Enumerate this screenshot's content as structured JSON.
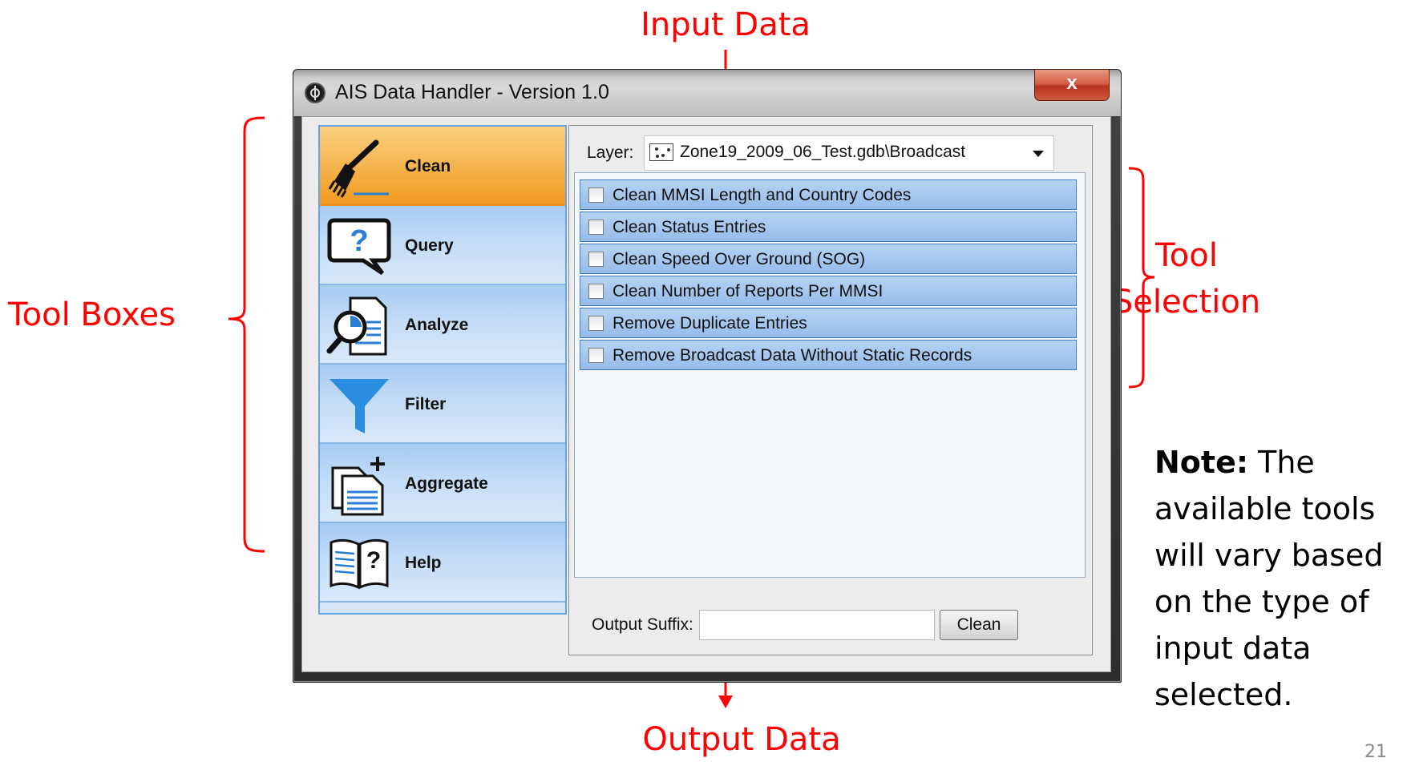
{
  "annotations": {
    "input_data": "Input Data",
    "output_data": "Output Data",
    "tool_boxes": "Tool Boxes",
    "tool_selection_line1": "Tool",
    "tool_selection_line2": "Selection",
    "note_bold": "Note:",
    "note_text": "The available tools will vary based on the type of input data selected.",
    "page_number": "21",
    "color": "#ff0000"
  },
  "window": {
    "title": "AIS Data Handler - Version 1.0",
    "close_label": "x"
  },
  "sidebar": {
    "items": [
      {
        "label": "Clean",
        "icon": "broom-icon",
        "active": true
      },
      {
        "label": "Query",
        "icon": "question-bubble-icon",
        "active": false
      },
      {
        "label": "Analyze",
        "icon": "magnifier-document-icon",
        "active": false
      },
      {
        "label": "Filter",
        "icon": "funnel-icon",
        "active": false
      },
      {
        "label": "Aggregate",
        "icon": "aggregate-documents-icon",
        "active": false
      },
      {
        "label": "Help",
        "icon": "help-book-icon",
        "active": false
      }
    ]
  },
  "panel": {
    "layer_label": "Layer:",
    "layer_value": "Zone19_2009_06_Test.gdb\\Broadcast",
    "tools": [
      {
        "label": "Clean MMSI Length and Country Codes",
        "checked": false
      },
      {
        "label": "Clean Status Entries",
        "checked": false
      },
      {
        "label": "Clean Speed Over Ground (SOG)",
        "checked": false
      },
      {
        "label": "Clean Number of Reports Per MMSI",
        "checked": false
      },
      {
        "label": "Remove Duplicate Entries",
        "checked": false
      },
      {
        "label": "Remove Broadcast Data Without Static Records",
        "checked": false
      }
    ],
    "output_suffix_label": "Output Suffix:",
    "output_suffix_value": "",
    "clean_button": "Clean"
  },
  "colors": {
    "active_tab": "#f4b24a",
    "tab": "#c2dbf6",
    "tool_item": "#a8c8ef"
  }
}
